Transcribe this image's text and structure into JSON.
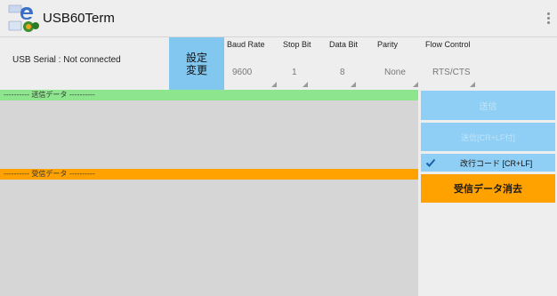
{
  "app": {
    "title": "USB60Term",
    "logo_icon": "usb60term-logo-icon",
    "menu_icon": "overflow-menu-icon"
  },
  "connection": {
    "status": "USB Serial : Not connected"
  },
  "config_button": {
    "line1": "設定",
    "line2": "変更"
  },
  "params": [
    {
      "label": "Baud Rate",
      "value": "9600"
    },
    {
      "label": "Stop Bit",
      "value": "1"
    },
    {
      "label": "Data Bit",
      "value": "8"
    },
    {
      "label": "Parity",
      "value": "None"
    },
    {
      "label": "Flow Control",
      "value": "RTS/CTS"
    }
  ],
  "send_panel": {
    "header": "---------- 送信データ ----------"
  },
  "receive_panel": {
    "header": "---------- 受信データ ----------"
  },
  "actions": {
    "send": "送信",
    "send_crlf": "送信[CR+LF付]",
    "newline_code": "改行コード [CR+LF]",
    "newline_checked": true,
    "clear_received": "受信データ消去"
  },
  "colors": {
    "accent_blue": "#81c7f0",
    "send_green": "#8de68d",
    "receive_orange": "#ffa200"
  }
}
